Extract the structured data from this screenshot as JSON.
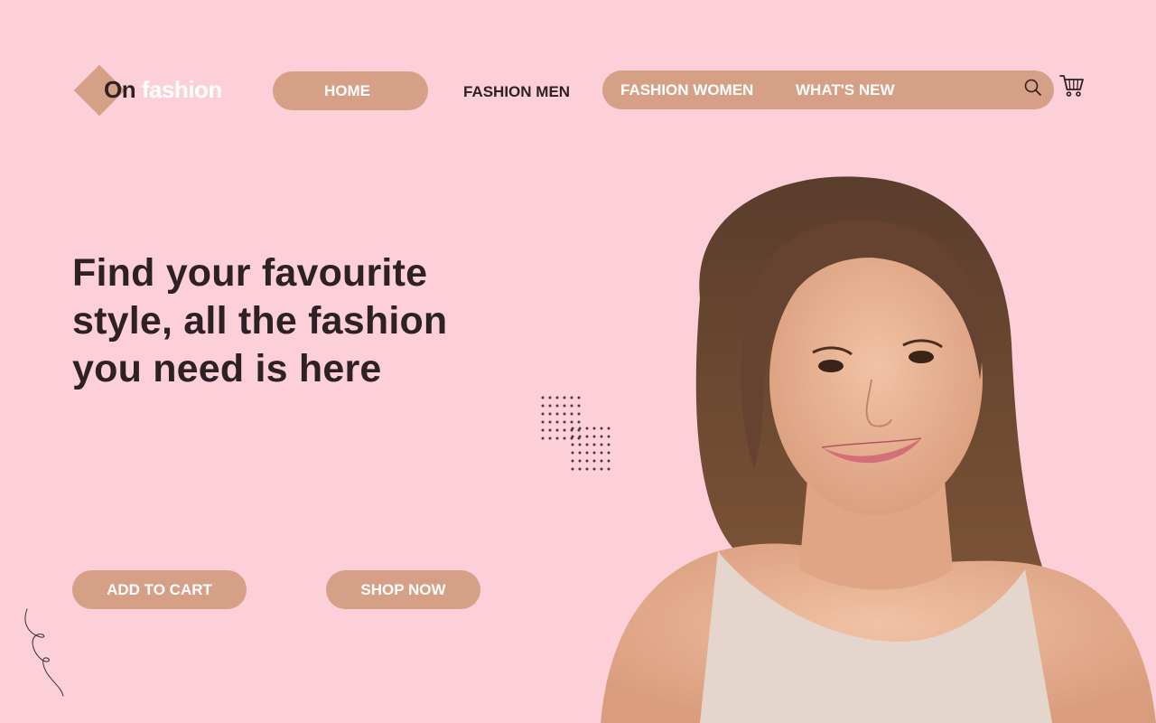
{
  "brand": {
    "word1": "On",
    "word2": "fashion"
  },
  "nav": {
    "home": "HOME",
    "men": "FASHION MEN",
    "women": "FASHION WOMEN",
    "new": "WHAT'S  NEW"
  },
  "icons": {
    "search": "search-icon",
    "cart": "cart-icon"
  },
  "hero": {
    "line1": "Find your favourite",
    "line2": "style, all the fashion",
    "line3": "you need is here"
  },
  "buttons": {
    "add_to_cart": "ADD TO CART",
    "shop_now": "SHOP NOW"
  },
  "colors": {
    "background": "#fdd0d9",
    "accent": "#d6a086",
    "text": "#2d2125"
  }
}
